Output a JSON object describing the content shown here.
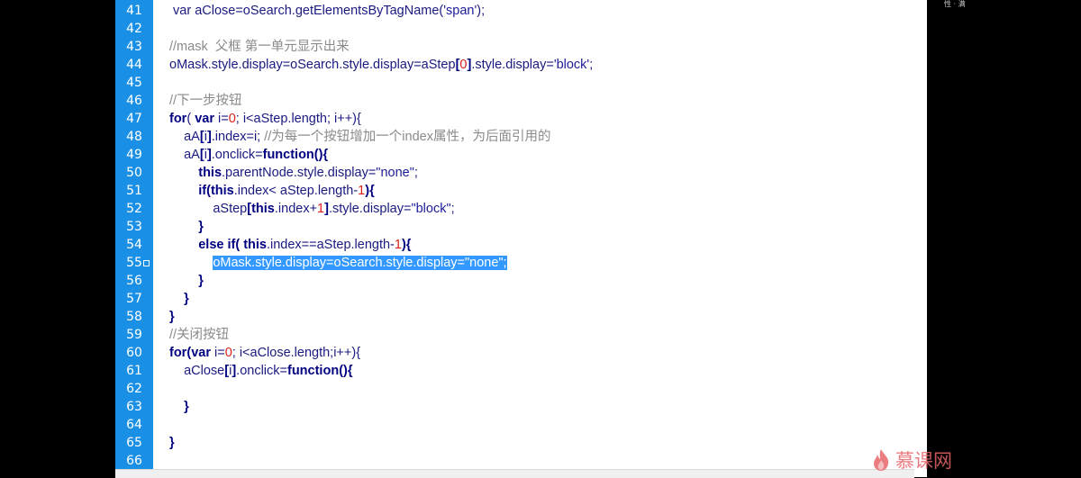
{
  "corner_label": "性 · 满",
  "watermark": {
    "text": "慕课网",
    "icon": "flame-logo-icon"
  },
  "colors": {
    "gutter": "#1a8fe6",
    "keyword": "#000080",
    "number": "#e0201e",
    "comment": "#8a8a8a",
    "selection": "#3399ff",
    "plain": "#1a1a80"
  },
  "lines": [
    {
      "n": "41",
      "tokens": [
        [
          "t",
          " var aClose=oSearch.getElementsByTagName("
        ],
        [
          "str",
          "'span'"
        ],
        [
          "t",
          ");"
        ]
      ]
    },
    {
      "n": "42",
      "tokens": []
    },
    {
      "n": "43",
      "tokens": [
        [
          "cm",
          "//mask  父框 第一单元显示出来"
        ]
      ]
    },
    {
      "n": "44",
      "tokens": [
        [
          "t",
          "oMask.style.display=oSearch.style.display=aStep"
        ],
        [
          "kw",
          "["
        ],
        [
          "num",
          "0"
        ],
        [
          "kw",
          "]"
        ],
        [
          "t",
          ".style.display="
        ],
        [
          "str",
          "'block'"
        ],
        [
          "t",
          ";"
        ]
      ]
    },
    {
      "n": "45",
      "tokens": []
    },
    {
      "n": "46",
      "tokens": [
        [
          "cm",
          "//下一步按钮"
        ]
      ]
    },
    {
      "n": "47",
      "tokens": [
        [
          "kw",
          "for"
        ],
        [
          "t",
          "( "
        ],
        [
          "kw",
          "var"
        ],
        [
          "t",
          " i="
        ],
        [
          "num",
          "0"
        ],
        [
          "t",
          "; i<aStep.length; i++){"
        ]
      ]
    },
    {
      "n": "48",
      "tokens": [
        [
          "t",
          "    aA"
        ],
        [
          "kw",
          "["
        ],
        [
          "t",
          "i"
        ],
        [
          "kw",
          "]"
        ],
        [
          "t",
          ".index=i; "
        ],
        [
          "cm",
          "//为每一个按钮增加一个index属性，为后面引用的"
        ]
      ]
    },
    {
      "n": "49",
      "tokens": [
        [
          "t",
          "    aA"
        ],
        [
          "kw",
          "["
        ],
        [
          "t",
          "i"
        ],
        [
          "kw",
          "]"
        ],
        [
          "t",
          ".onclick="
        ],
        [
          "kw",
          "function"
        ],
        [
          "kw",
          "(){"
        ]
      ]
    },
    {
      "n": "50",
      "tokens": [
        [
          "t",
          "        "
        ],
        [
          "kw",
          "this"
        ],
        [
          "t",
          ".parentNode.style.display="
        ],
        [
          "str",
          "\"none\""
        ],
        [
          "t",
          ";"
        ]
      ]
    },
    {
      "n": "51",
      "tokens": [
        [
          "t",
          "        "
        ],
        [
          "kw",
          "if"
        ],
        [
          "kw",
          "("
        ],
        [
          "kw",
          "this"
        ],
        [
          "t",
          ".index< aStep.length-"
        ],
        [
          "num",
          "1"
        ],
        [
          "kw",
          "){"
        ]
      ]
    },
    {
      "n": "52",
      "tokens": [
        [
          "t",
          "            aStep"
        ],
        [
          "kw",
          "["
        ],
        [
          "kw",
          "this"
        ],
        [
          "t",
          ".index+"
        ],
        [
          "num",
          "1"
        ],
        [
          "kw",
          "]"
        ],
        [
          "t",
          ".style.display="
        ],
        [
          "str",
          "\"block\""
        ],
        [
          "t",
          ";"
        ]
      ]
    },
    {
      "n": "53",
      "tokens": [
        [
          "t",
          "        "
        ],
        [
          "kw",
          "}"
        ]
      ]
    },
    {
      "n": "54",
      "tokens": [
        [
          "t",
          "        "
        ],
        [
          "kw",
          "else if"
        ],
        [
          "kw",
          "( "
        ],
        [
          "kw",
          "this"
        ],
        [
          "t",
          ".index==aStep.length-"
        ],
        [
          "num",
          "1"
        ],
        [
          "kw",
          "){"
        ]
      ]
    },
    {
      "n": "55",
      "marker": true,
      "tokens": [
        [
          "t",
          "            "
        ],
        [
          "sel",
          "oMask.style.display=oSearch.style.display=\"none\";"
        ]
      ]
    },
    {
      "n": "56",
      "tokens": [
        [
          "t",
          "        "
        ],
        [
          "kw",
          "}"
        ]
      ]
    },
    {
      "n": "57",
      "tokens": [
        [
          "t",
          "    "
        ],
        [
          "kw",
          "}"
        ]
      ]
    },
    {
      "n": "58",
      "tokens": [
        [
          "kw",
          "}"
        ]
      ]
    },
    {
      "n": "59",
      "tokens": [
        [
          "cm",
          "//关闭按钮"
        ]
      ]
    },
    {
      "n": "60",
      "tokens": [
        [
          "kw",
          "for"
        ],
        [
          "kw",
          "("
        ],
        [
          "kw",
          "var"
        ],
        [
          "t",
          " i="
        ],
        [
          "num",
          "0"
        ],
        [
          "t",
          "; i<aClose.length;i++){"
        ]
      ]
    },
    {
      "n": "61",
      "tokens": [
        [
          "t",
          "    aClose"
        ],
        [
          "kw",
          "["
        ],
        [
          "t",
          "i"
        ],
        [
          "kw",
          "]"
        ],
        [
          "t",
          ".onclick="
        ],
        [
          "kw",
          "function"
        ],
        [
          "kw",
          "(){"
        ]
      ]
    },
    {
      "n": "62",
      "tokens": []
    },
    {
      "n": "63",
      "tokens": [
        [
          "t",
          "    "
        ],
        [
          "kw",
          "}"
        ]
      ]
    },
    {
      "n": "64",
      "tokens": []
    },
    {
      "n": "65",
      "tokens": [
        [
          "kw",
          "}"
        ]
      ]
    },
    {
      "n": "66",
      "tokens": []
    }
  ]
}
